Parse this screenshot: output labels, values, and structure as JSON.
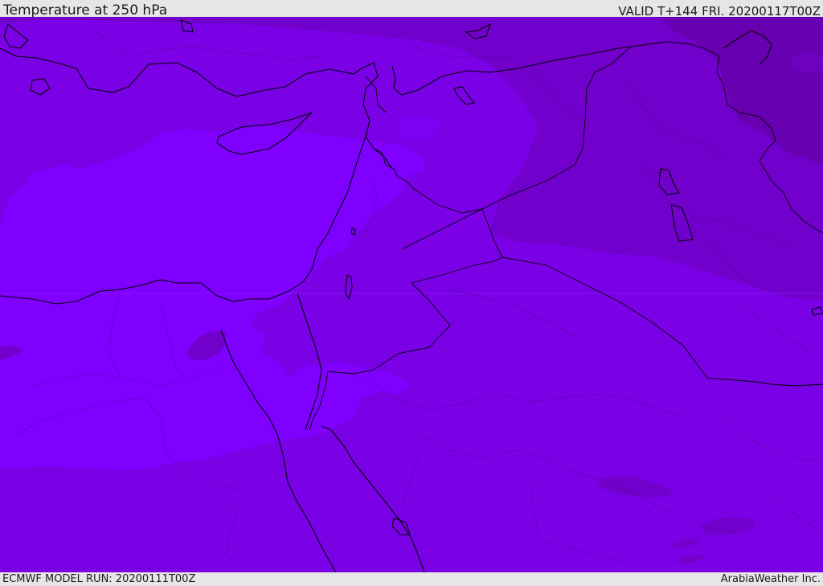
{
  "header": {
    "title": "Temperature at 250 hPa",
    "valid": "VALID T+144 FRI. 20200117T00Z"
  },
  "footer": {
    "model_run": "ECMWF MODEL RUN: 20200111T00Z",
    "brand": "ArabiaWeather Inc."
  },
  "colors": {
    "band_warm": "#7f00ff",
    "band_mid": "#7a00e6",
    "band_cool": "#7200cc",
    "band_cold": "#6600b0",
    "coast": "#000000",
    "border_dotted": "#2a0055"
  }
}
